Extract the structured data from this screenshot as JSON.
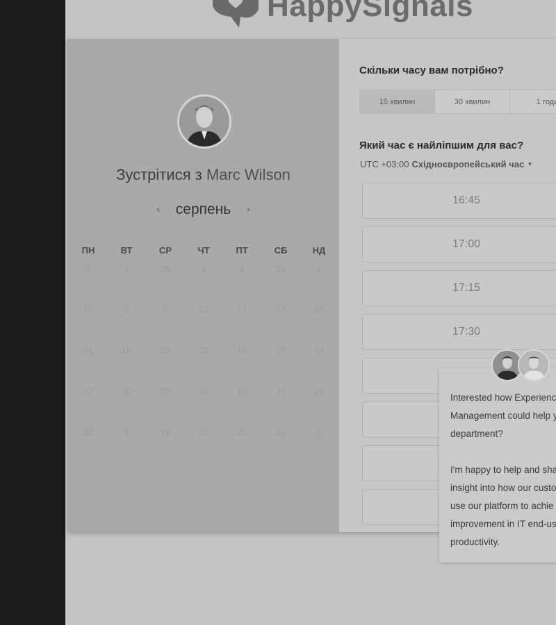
{
  "brand": {
    "name": "HappySignals"
  },
  "host": {
    "meet_prefix": "Зустрітися з ",
    "name": "Marc Wilson"
  },
  "calendar": {
    "month": "серпень",
    "prev_icon": "‹",
    "next_icon": "›",
    "weekdays": [
      "ПН",
      "ВТ",
      "СР",
      "ЧТ",
      "ПТ",
      "СБ",
      "НД"
    ],
    "weeks": [
      [
        "3",
        "1",
        "25",
        "4",
        "4",
        "13",
        "1"
      ],
      [
        "10",
        "8",
        "2",
        "22",
        "21",
        "14",
        "12"
      ],
      [
        "21",
        "15",
        "25",
        "23",
        "10",
        "27",
        "14"
      ],
      [
        "22",
        "10",
        "23",
        "12",
        "18",
        "21",
        "21"
      ],
      [
        "12",
        "5",
        "18",
        "21",
        "25",
        "31",
        "3"
      ]
    ]
  },
  "booking": {
    "duration_question": "Скільки часу вам потрібно?",
    "durations": [
      "15 хвилин",
      "30 хвилин",
      "1 годи"
    ],
    "selected_duration": "15 хвилин",
    "time_question": "Який час є найліпшим для вас?",
    "tz_offset": "UTC +03:00",
    "tz_name": "Східноєвропейський час",
    "tz_caret": "▾",
    "slots": [
      "16:45",
      "17:00",
      "17:15",
      "17:30",
      "",
      "",
      ""
    ]
  },
  "chat": {
    "lines_a": [
      "Interested how Experienc",
      "Management could help y",
      "department?"
    ],
    "lines_b": [
      "I'm happy to help and sha",
      "insight into how our custo",
      "use our platform to achie",
      "improvement in IT end-us",
      "productivity."
    ]
  },
  "icons": {
    "logo": "chat-bubble-heart-icon",
    "tz_caret": "caret-down-icon"
  },
  "colors": {
    "left_panel": "#a9a9a9",
    "right_panel": "#c6c6c6",
    "left_strip": "#1c1c1c"
  }
}
